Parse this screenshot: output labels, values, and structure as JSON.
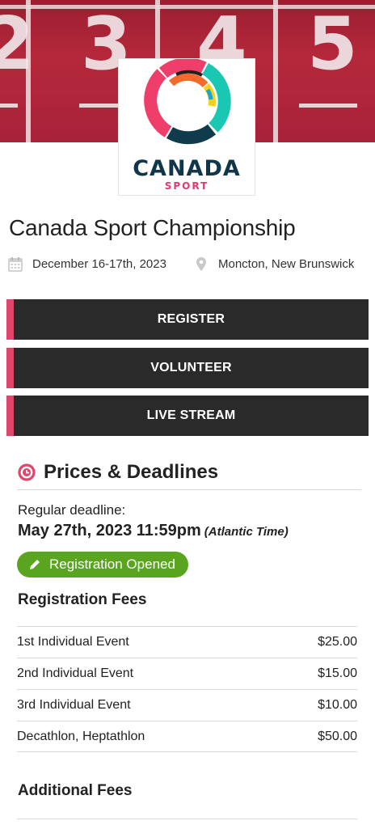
{
  "hero": {
    "lane_numbers": [
      "2",
      "3",
      "4",
      "5"
    ],
    "logo": {
      "wordmark": "CANADA",
      "sub": "SPORT"
    }
  },
  "event": {
    "title": "Canada Sport Championship",
    "date": "December 16-17th, 2023",
    "location": "Moncton, New Brunswick"
  },
  "actions": {
    "register": "REGISTER",
    "volunteer": "VOLUNTEER",
    "live_stream": "LIVE STREAM"
  },
  "colors": {
    "accent": "#e0466b",
    "button_bg": "#2a2a2a",
    "status_green": "#5aa520",
    "brand_navy": "#10364a"
  },
  "prices": {
    "heading": "Prices & Deadlines",
    "deadline_label": "Regular deadline:",
    "deadline_date": "May 27th, 2023 11:59pm",
    "deadline_tz": "(Atlantic Time)",
    "status": "Registration Opened",
    "fees_heading": "Registration Fees",
    "fees": [
      {
        "name": "1st Individual Event",
        "price": "$25.00"
      },
      {
        "name": "2nd Individual Event",
        "price": "$15.00"
      },
      {
        "name": "3rd Individual Event",
        "price": "$10.00"
      },
      {
        "name": "Decathlon, Heptathlon",
        "price": "$50.00"
      }
    ],
    "additional_heading": "Additional Fees"
  },
  "icons": {
    "date": "calendar-icon",
    "location": "map-pin-icon",
    "section": "clock-icon",
    "status": "pencil-icon"
  }
}
